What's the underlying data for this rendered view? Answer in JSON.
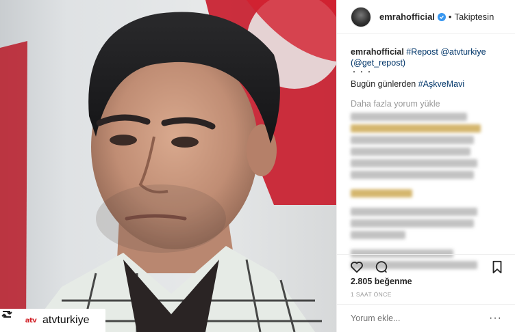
{
  "post": {
    "author": "emrahofficial",
    "follow_status": "Takiptesin",
    "separator": "•"
  },
  "caption": {
    "author": "emrahofficial",
    "repost_tag": "#Repost",
    "repost_mention": "@atvturkiye",
    "get_repost": "(@get_repost)",
    "emoji_line": "・・・",
    "text": "Bugün günlerden",
    "hashtag": "#AşkveMavi"
  },
  "comments": {
    "load_more": "Daha fazla yorum yükle"
  },
  "actions": {
    "likes": "2.805 beğenme",
    "time": "1 SAAT ÖNCE"
  },
  "comment_box": {
    "placeholder": "Yorum ekle...",
    "more": "···"
  },
  "repost_badge": {
    "logo_text": "atv",
    "username": "atvturkiye"
  },
  "colors": {
    "link": "#003569",
    "verified": "#3897f0",
    "muted": "#999999",
    "flag_red": "#c8192a"
  },
  "icons": [
    "repost-icon",
    "verified-badge-icon",
    "heart-icon",
    "comment-icon",
    "bookmark-icon",
    "more-options-icon"
  ]
}
